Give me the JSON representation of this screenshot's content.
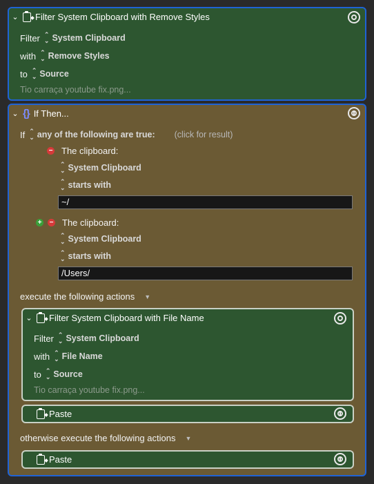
{
  "block1": {
    "title": "Filter System Clipboard with Remove Styles",
    "filter_label": "Filter",
    "filter_value": "System Clipboard",
    "with_label": "with",
    "with_value": "Remove Styles",
    "to_label": "to",
    "to_value": "Source",
    "preview": "Tio carraça youtube fix.png..."
  },
  "ifthen": {
    "title": "If Then...",
    "if_label": "If",
    "condition_mode": "any of the following are true:",
    "click_hint": "(click for result)",
    "conditions": [
      {
        "label": "The clipboard:",
        "source": "System Clipboard",
        "operator": "starts with",
        "value": "~/"
      },
      {
        "label": "The clipboard:",
        "source": "System Clipboard",
        "operator": "starts with",
        "value": "/Users/"
      }
    ],
    "execute_label": "execute the following actions",
    "otherwise_label": "otherwise execute the following actions"
  },
  "inner": {
    "title": "Filter System Clipboard with File Name",
    "filter_label": "Filter",
    "filter_value": "System Clipboard",
    "with_label": "with",
    "with_value": "File Name",
    "to_label": "to",
    "to_value": "Source",
    "preview": "Tio carraça youtube fix.png..."
  },
  "paste1": {
    "title": "Paste"
  },
  "paste2": {
    "title": "Paste"
  },
  "colors": {
    "green_block": "#2d5630",
    "olive_block": "#6b5a34",
    "selected_border": "#1f63d6"
  }
}
